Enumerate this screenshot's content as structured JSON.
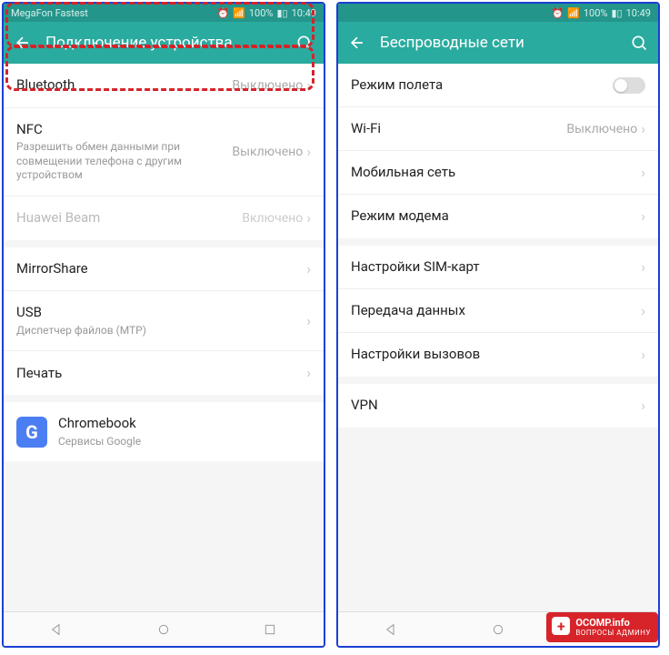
{
  "status": {
    "carrier": "MegaFon Fastest",
    "battery": "100%",
    "time": "10:49"
  },
  "left": {
    "title": "Подключение устройства",
    "bluetooth": {
      "label": "Bluetooth",
      "value": "Выключено"
    },
    "nfc": {
      "label": "NFC",
      "sub": "Разрешить обмен данными при совмещении телефона с другим устройством",
      "value": "Выключено"
    },
    "beam": {
      "label": "Huawei Beam",
      "value": "Включено"
    },
    "mirror": {
      "label": "MirrorShare"
    },
    "usb": {
      "label": "USB",
      "sub": "Диспетчер файлов (MTP)"
    },
    "print": {
      "label": "Печать"
    },
    "chromebook": {
      "label": "Chromebook",
      "sub": "Сервисы Google"
    }
  },
  "right": {
    "title": "Беспроводные сети",
    "airplane": {
      "label": "Режим полета"
    },
    "wifi": {
      "label": "Wi-Fi",
      "value": "Выключено"
    },
    "mobile": {
      "label": "Мобильная сеть"
    },
    "modem": {
      "label": "Режим модема"
    },
    "sim": {
      "label": "Настройки SIM-карт"
    },
    "data": {
      "label": "Передача данных"
    },
    "calls": {
      "label": "Настройки вызовов"
    },
    "vpn": {
      "label": "VPN"
    }
  },
  "watermark": {
    "main": "OCOMP.info",
    "sub": "ВОПРОСЫ АДМИНУ"
  }
}
